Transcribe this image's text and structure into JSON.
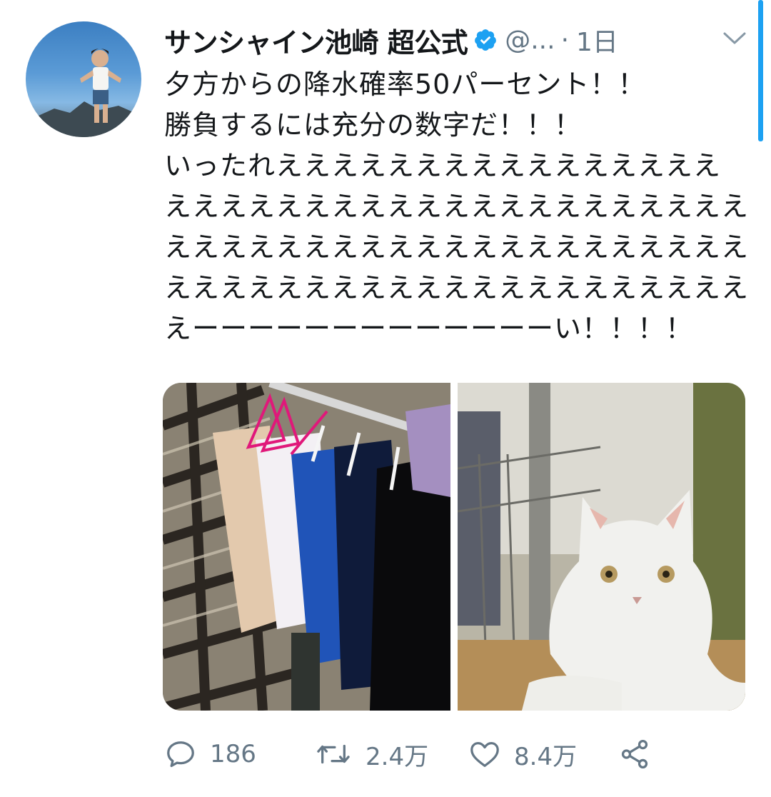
{
  "tweet": {
    "author_name": "サンシャイン池崎 超公式",
    "handle": "@...",
    "separator": "·",
    "time": "1日",
    "text_lines": [
      "夕方からの降水確率50パーセント！！",
      "勝負するには充分の数字だ！！！",
      "いったれええええええええええええええええ",
      "えええええええええええええええええええええ",
      "えええええええええええええええええええええ",
      "えええええええええええええええええええええ",
      "えーーーーーーーーーーーーーい！！！！"
    ],
    "media": [
      {
        "name": "laundry-photo"
      },
      {
        "name": "cat-photo"
      }
    ]
  },
  "actions": {
    "reply_count": "186",
    "retweet_count": "2.4万",
    "like_count": "8.4万"
  },
  "icons": {
    "verified": "verified-badge-icon",
    "caret": "chevron-down-icon",
    "reply": "reply-icon",
    "retweet": "retweet-icon",
    "like": "heart-icon",
    "share": "share-icon"
  },
  "colors": {
    "text": "#14171a",
    "muted": "#657786",
    "accent": "#1da1f2"
  }
}
